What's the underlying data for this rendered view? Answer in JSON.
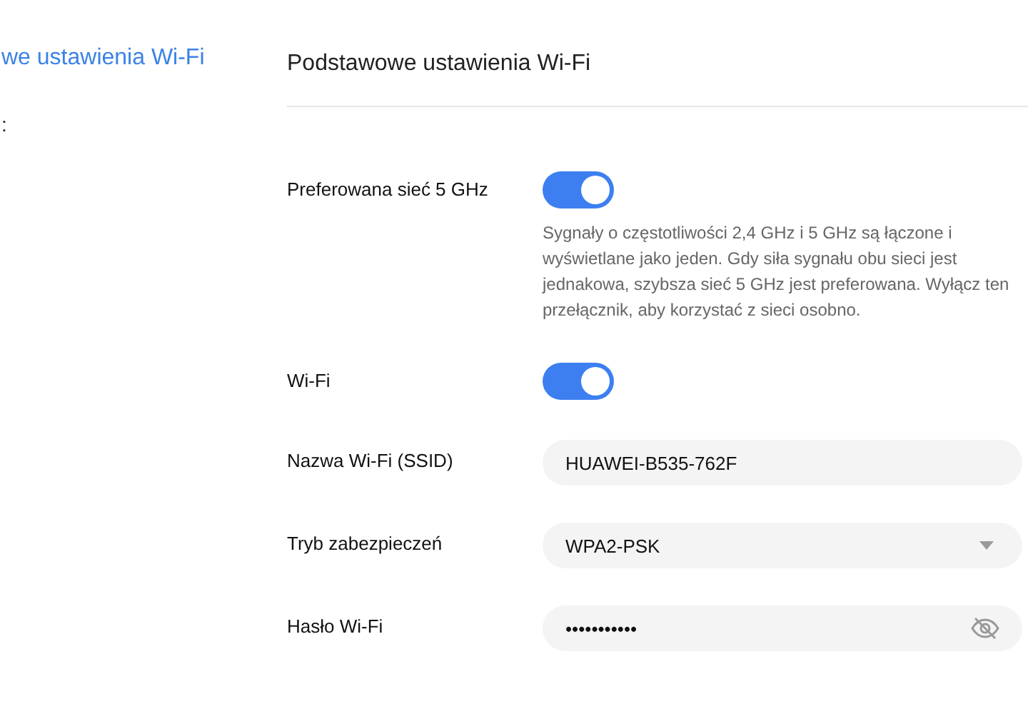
{
  "sidebar": {
    "items": [
      {
        "label": "we ustawienia Wi-Fi",
        "selected": true
      },
      {
        "label": ":",
        "selected": false
      }
    ]
  },
  "page": {
    "title": "Podstawowe ustawienia Wi-Fi"
  },
  "settings": [
    {
      "kind": "toggle",
      "label": "Preferowana sieć 5 GHz",
      "on": true,
      "description": "Sygnały o częstotliwości 2,4 GHz i 5 GHz są łączone i wyświetlane jako jeden. Gdy siła sygnału obu sieci jest jednakowa, szybsza sieć 5 GHz jest preferowana. Wyłącz ten przełącznik, aby korzystać z sieci osobno."
    },
    {
      "kind": "toggle",
      "label": "Wi-Fi",
      "on": true
    },
    {
      "kind": "text",
      "label": "Nazwa Wi-Fi (SSID)",
      "value": "HUAWEI-B535-762F"
    },
    {
      "kind": "select",
      "label": "Tryb zabezpieczeń",
      "value": "WPA2-PSK"
    },
    {
      "kind": "password",
      "label": "Hasło Wi-Fi",
      "value": "•••••••••••"
    }
  ]
}
